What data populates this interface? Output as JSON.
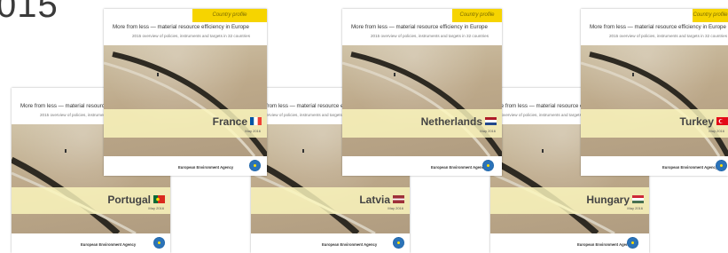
{
  "year_label": "015",
  "report": {
    "title": "More from less — material resource efficiency in Europe",
    "subtitle": "2015 overview of policies, instruments and targets in 32 countries",
    "badge": "Country profile",
    "date": "May 2016",
    "agency": "European Environment Agency"
  },
  "covers": [
    {
      "country": "Portugal",
      "flag": "portugal-flag-icon"
    },
    {
      "country": "France",
      "flag": "france-flag-icon"
    },
    {
      "country": "Latvia",
      "flag": "latvia-flag-icon"
    },
    {
      "country": "Netherlands",
      "flag": "netherlands-flag-icon"
    },
    {
      "country": "Hungary",
      "flag": "hungary-flag-icon"
    },
    {
      "country": "Turkey",
      "flag": "turkey-flag-icon"
    }
  ],
  "colors": {
    "badge_yellow": "#f6d400",
    "band_yellow": "#fcf8be",
    "logo_blue": "#2b73b8"
  }
}
